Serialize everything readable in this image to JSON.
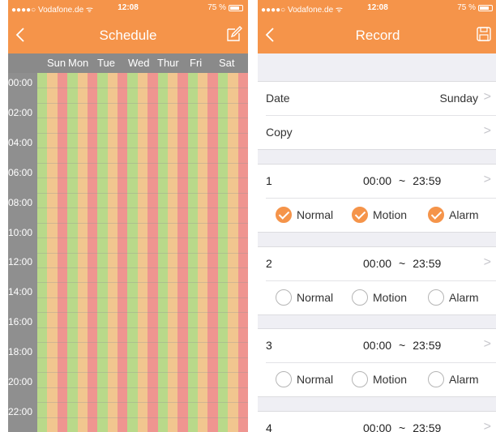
{
  "left": {
    "status": {
      "carrier": "●●●●○ Vodafone.de ᯤ",
      "time": "12:08",
      "battery": "75 %",
      "battery_level": 0.75
    },
    "title": "Schedule",
    "days": [
      "Sun",
      "Mon",
      "Tue",
      "Wed",
      "Thur",
      "Fri",
      "Sat"
    ],
    "times": [
      "00:00",
      "02:00",
      "04:00",
      "06:00",
      "08:00",
      "10:00",
      "12:00",
      "14:00",
      "16:00",
      "18:00",
      "20:00",
      "22:00"
    ],
    "stripe_colors": [
      "#b9d98a",
      "#f1c68f",
      "#ef9590"
    ],
    "colors": {
      "accent": "#f5944a"
    }
  },
  "right": {
    "status": {
      "carrier": "●●●●○ Vodafone.de ᯤ",
      "time": "12:08",
      "battery": "75 %",
      "battery_level": 0.75
    },
    "title": "Record",
    "date_label": "Date",
    "date_value": "Sunday",
    "copy_label": "Copy",
    "schedules": [
      {
        "num": "1",
        "start": "00:00",
        "tilde": "~",
        "end": "23:59",
        "normal": "Normal",
        "motion": "Motion",
        "alarm": "Alarm",
        "normal_on": true,
        "motion_on": true,
        "alarm_on": true
      },
      {
        "num": "2",
        "start": "00:00",
        "tilde": "~",
        "end": "23:59",
        "normal": "Normal",
        "motion": "Motion",
        "alarm": "Alarm",
        "normal_on": false,
        "motion_on": false,
        "alarm_on": false
      },
      {
        "num": "3",
        "start": "00:00",
        "tilde": "~",
        "end": "23:59",
        "normal": "Normal",
        "motion": "Motion",
        "alarm": "Alarm",
        "normal_on": false,
        "motion_on": false,
        "alarm_on": false
      },
      {
        "num": "4",
        "start": "00:00",
        "tilde": "~",
        "end": "23:59"
      }
    ]
  }
}
